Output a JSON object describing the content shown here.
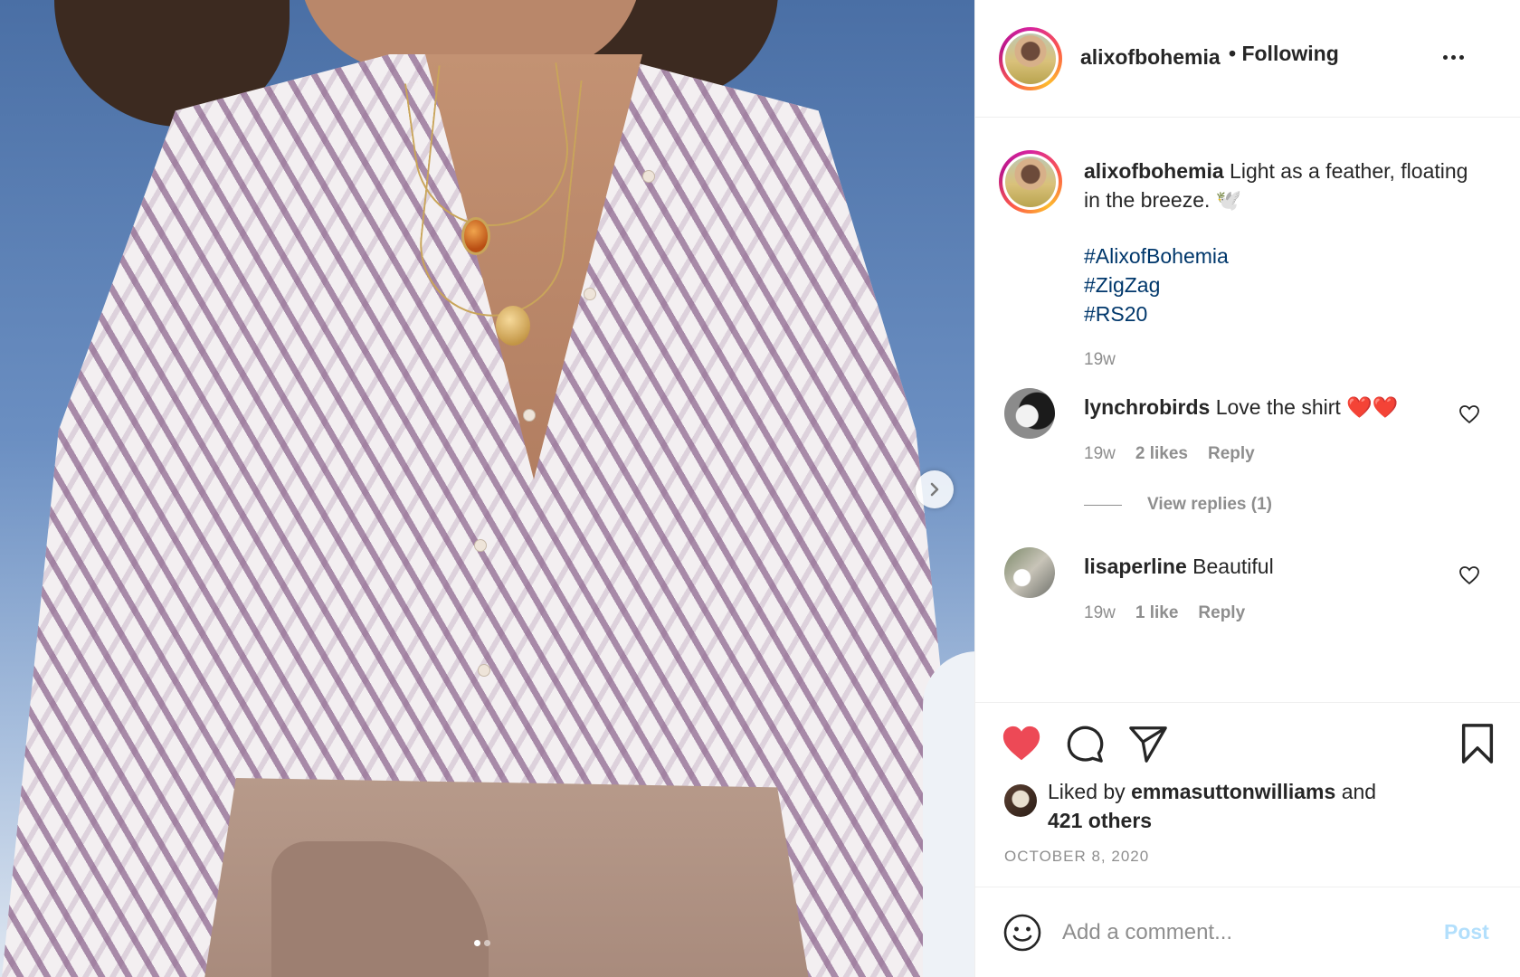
{
  "header": {
    "username": "alixofbohemia",
    "separator": "•",
    "follow_status": "Following",
    "more_icon": "more-horizontal-icon"
  },
  "caption": {
    "username": "alixofbohemia",
    "text": "Light as a feather, floating in the breeze. 🕊️",
    "hashtags": [
      "#AlixofBohemia",
      "#ZigZag",
      "#RS20"
    ],
    "time": "19w"
  },
  "comments": [
    {
      "username": "lynchrobirds",
      "text": "Love the shirt ❤️❤️",
      "time": "19w",
      "likes": "2 likes",
      "reply": "Reply",
      "view_replies": "View replies (1)"
    },
    {
      "username": "lisaperline",
      "text": "Beautiful",
      "time": "19w",
      "likes": "1 like",
      "reply": "Reply"
    }
  ],
  "actions": {
    "like_icon": "heart-filled-icon",
    "like_color": "#ed4956",
    "comment_icon": "comment-icon",
    "share_icon": "paper-plane-icon",
    "save_icon": "bookmark-icon"
  },
  "likes": {
    "prefix": "Liked by",
    "user": "emmasuttonwilliams",
    "and": "and",
    "others": "421 others"
  },
  "date": "OCTOBER 8, 2020",
  "add_comment": {
    "placeholder": "Add a comment...",
    "post_label": "Post",
    "emoji_icon": "smiley-icon"
  },
  "media": {
    "next_icon": "chevron-right-icon",
    "carousel_count": 2,
    "carousel_active": 1
  }
}
